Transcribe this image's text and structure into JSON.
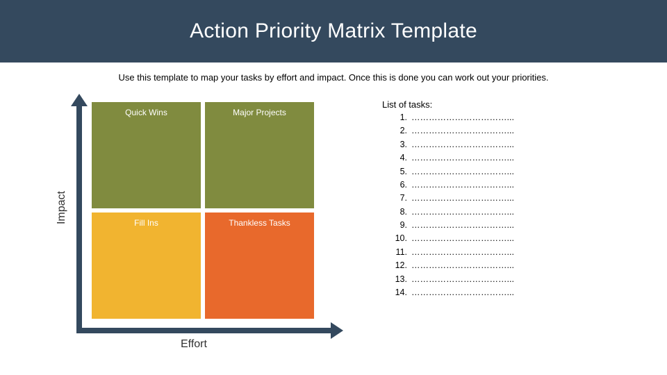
{
  "header": {
    "title": "Action Priority Matrix Template"
  },
  "subtitle": "Use this template to map your tasks by effort and impact. Once this is done you can work out your priorities.",
  "matrix": {
    "y_label": "Impact",
    "x_label": "Effort",
    "quadrants": {
      "top_left": "Quick Wins",
      "top_right": "Major Projects",
      "bottom_left": "Fill Ins",
      "bottom_right": "Thankless Tasks"
    },
    "colors": {
      "top": "#808b3f",
      "bottom_left": "#f1b430",
      "bottom_right": "#e8692c",
      "axis": "#34495e"
    }
  },
  "tasks": {
    "heading": "List of tasks:",
    "items": [
      {
        "n": "1.",
        "text": "……………………………..."
      },
      {
        "n": "2.",
        "text": "……………………………..."
      },
      {
        "n": "3.",
        "text": "……………………………..."
      },
      {
        "n": "4.",
        "text": "……………………………..."
      },
      {
        "n": "5.",
        "text": "……………………………..."
      },
      {
        "n": "6.",
        "text": "……………………………..."
      },
      {
        "n": "7.",
        "text": "……………………………..."
      },
      {
        "n": "8.",
        "text": "……………………………..."
      },
      {
        "n": "9.",
        "text": "……………………………..."
      },
      {
        "n": "10.",
        "text": "……………………………..."
      },
      {
        "n": "11.",
        "text": "……………………………..."
      },
      {
        "n": "12.",
        "text": "……………………………..."
      },
      {
        "n": "13.",
        "text": "……………………………..."
      },
      {
        "n": "14.",
        "text": "……………………………..."
      }
    ]
  }
}
